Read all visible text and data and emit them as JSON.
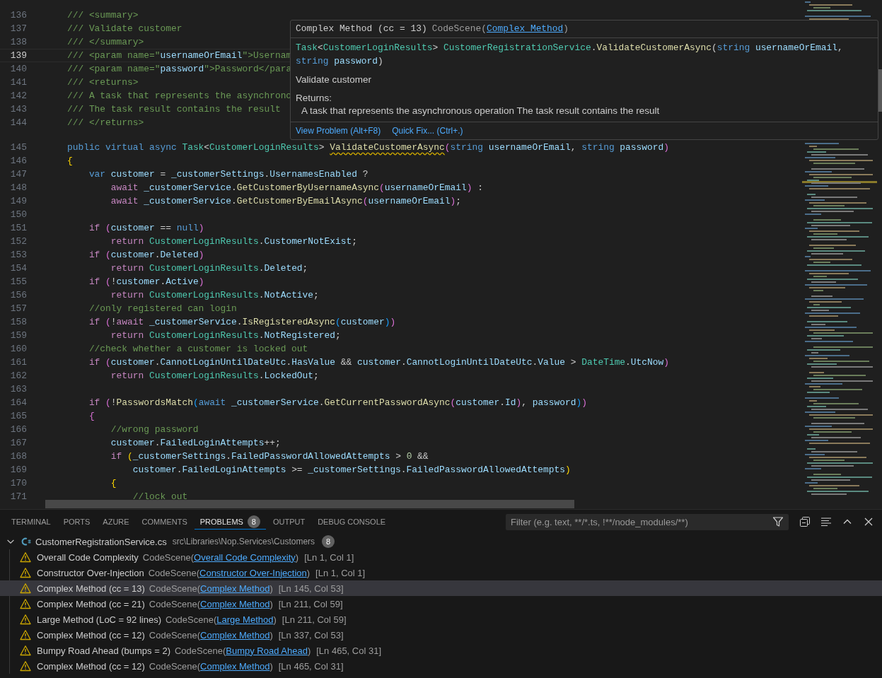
{
  "editor": {
    "lines": [
      {
        "number": "136",
        "current": false,
        "tokens": [
          {
            "text": "    /// <summary>",
            "kind": "cm"
          }
        ]
      },
      {
        "number": "137",
        "current": false,
        "tokens": [
          {
            "text": "    /// Validate customer",
            "kind": "cm"
          }
        ]
      },
      {
        "number": "138",
        "current": false,
        "tokens": [
          {
            "text": "    /// </summary>",
            "kind": "cm"
          }
        ]
      },
      {
        "number": "139",
        "current": true,
        "tokens": [
          {
            "text": "    /// <param name=\"",
            "kind": "cm"
          },
          {
            "text": "usernameOrEmail",
            "kind": "dv"
          },
          {
            "text": "\">Usernam",
            "kind": "cm"
          }
        ]
      },
      {
        "number": "140",
        "current": false,
        "tokens": [
          {
            "text": "    /// <param name=\"",
            "kind": "cm"
          },
          {
            "text": "password",
            "kind": "dv"
          },
          {
            "text": "\">Password</para",
            "kind": "cm"
          }
        ]
      },
      {
        "number": "141",
        "current": false,
        "tokens": [
          {
            "text": "    /// <returns>",
            "kind": "cm"
          }
        ]
      },
      {
        "number": "142",
        "current": false,
        "tokens": [
          {
            "text": "    /// A task that represents the asynchrono",
            "kind": "cm"
          }
        ]
      },
      {
        "number": "143",
        "current": false,
        "tokens": [
          {
            "text": "    /// The task result contains the result",
            "kind": "cm"
          }
        ]
      },
      {
        "number": "144",
        "current": false,
        "tokens": [
          {
            "text": "    /// </returns>",
            "kind": "cm"
          }
        ]
      },
      {
        "number": "145",
        "current": false,
        "tokens": [
          {
            "text": "    public virtual async ",
            "kind": "kw"
          },
          {
            "text": "Task",
            "kind": "ty"
          },
          {
            "text": "<",
            "kind": "p"
          },
          {
            "text": "CustomerLoginResults",
            "kind": "ty"
          },
          {
            "text": "> ",
            "kind": "p"
          },
          {
            "text": "ValidateCustomerAsync",
            "kind": "fnw"
          },
          {
            "text": "(",
            "kind": "b2"
          },
          {
            "text": "string ",
            "kind": "kw"
          },
          {
            "text": "usernameOrEmail",
            "kind": "v"
          },
          {
            "text": ", ",
            "kind": "p"
          },
          {
            "text": "string ",
            "kind": "kw"
          },
          {
            "text": "password",
            "kind": "v"
          },
          {
            "text": ")",
            "kind": "b2"
          }
        ]
      },
      {
        "number": "146",
        "current": false,
        "tokens": [
          {
            "text": "    {",
            "kind": "b1"
          }
        ]
      },
      {
        "number": "147",
        "current": false,
        "tokens": [
          {
            "text": "        var ",
            "kind": "kw"
          },
          {
            "text": "customer",
            "kind": "v"
          },
          {
            "text": " = ",
            "kind": "p"
          },
          {
            "text": "_customerSettings",
            "kind": "v"
          },
          {
            "text": ".",
            "kind": "p"
          },
          {
            "text": "UsernamesEnabled",
            "kind": "v"
          },
          {
            "text": " ?",
            "kind": "p"
          }
        ]
      },
      {
        "number": "148",
        "current": false,
        "tokens": [
          {
            "text": "            await ",
            "kind": "ct"
          },
          {
            "text": "_customerService",
            "kind": "v"
          },
          {
            "text": ".",
            "kind": "p"
          },
          {
            "text": "GetCustomerByUsernameAsync",
            "kind": "fn"
          },
          {
            "text": "(",
            "kind": "b2"
          },
          {
            "text": "usernameOrEmail",
            "kind": "v"
          },
          {
            "text": ")",
            "kind": "b2"
          },
          {
            "text": " :",
            "kind": "p"
          }
        ]
      },
      {
        "number": "149",
        "current": false,
        "tokens": [
          {
            "text": "            await ",
            "kind": "ct"
          },
          {
            "text": "_customerService",
            "kind": "v"
          },
          {
            "text": ".",
            "kind": "p"
          },
          {
            "text": "GetCustomerByEmailAsync",
            "kind": "fn"
          },
          {
            "text": "(",
            "kind": "b2"
          },
          {
            "text": "usernameOrEmail",
            "kind": "v"
          },
          {
            "text": ")",
            "kind": "b2"
          },
          {
            "text": ";",
            "kind": "p"
          }
        ]
      },
      {
        "number": "150",
        "current": false
      },
      {
        "number": "151",
        "current": false,
        "tokens": [
          {
            "text": "        if ",
            "kind": "ct"
          },
          {
            "text": "(",
            "kind": "b2"
          },
          {
            "text": "customer",
            "kind": "v"
          },
          {
            "text": " == ",
            "kind": "p"
          },
          {
            "text": "null",
            "kind": "kw"
          },
          {
            "text": ")",
            "kind": "b2"
          }
        ]
      },
      {
        "number": "152",
        "current": false,
        "tokens": [
          {
            "text": "            return ",
            "kind": "ct"
          },
          {
            "text": "CustomerLoginResults",
            "kind": "ty"
          },
          {
            "text": ".",
            "kind": "p"
          },
          {
            "text": "CustomerNotExist",
            "kind": "v"
          },
          {
            "text": ";",
            "kind": "p"
          }
        ]
      },
      {
        "number": "153",
        "current": false,
        "tokens": [
          {
            "text": "        if ",
            "kind": "ct"
          },
          {
            "text": "(",
            "kind": "b2"
          },
          {
            "text": "customer",
            "kind": "v"
          },
          {
            "text": ".",
            "kind": "p"
          },
          {
            "text": "Deleted",
            "kind": "v"
          },
          {
            "text": ")",
            "kind": "b2"
          }
        ]
      },
      {
        "number": "154",
        "current": false,
        "tokens": [
          {
            "text": "            return ",
            "kind": "ct"
          },
          {
            "text": "CustomerLoginResults",
            "kind": "ty"
          },
          {
            "text": ".",
            "kind": "p"
          },
          {
            "text": "Deleted",
            "kind": "v"
          },
          {
            "text": ";",
            "kind": "p"
          }
        ]
      },
      {
        "number": "155",
        "current": false,
        "tokens": [
          {
            "text": "        if ",
            "kind": "ct"
          },
          {
            "text": "(",
            "kind": "b2"
          },
          {
            "text": "!",
            "kind": "p"
          },
          {
            "text": "customer",
            "kind": "v"
          },
          {
            "text": ".",
            "kind": "p"
          },
          {
            "text": "Active",
            "kind": "v"
          },
          {
            "text": ")",
            "kind": "b2"
          }
        ]
      },
      {
        "number": "156",
        "current": false,
        "tokens": [
          {
            "text": "            return ",
            "kind": "ct"
          },
          {
            "text": "CustomerLoginResults",
            "kind": "ty"
          },
          {
            "text": ".",
            "kind": "p"
          },
          {
            "text": "NotActive",
            "kind": "v"
          },
          {
            "text": ";",
            "kind": "p"
          }
        ]
      },
      {
        "number": "157",
        "current": false,
        "tokens": [
          {
            "text": "        //only registered can login",
            "kind": "cm"
          }
        ]
      },
      {
        "number": "158",
        "current": false,
        "tokens": [
          {
            "text": "        if ",
            "kind": "ct"
          },
          {
            "text": "(",
            "kind": "b2"
          },
          {
            "text": "!",
            "kind": "p"
          },
          {
            "text": "await ",
            "kind": "ct"
          },
          {
            "text": "_customerService",
            "kind": "v"
          },
          {
            "text": ".",
            "kind": "p"
          },
          {
            "text": "IsRegisteredAsync",
            "kind": "fn"
          },
          {
            "text": "(",
            "kind": "b3"
          },
          {
            "text": "customer",
            "kind": "v"
          },
          {
            "text": ")",
            "kind": "b3"
          },
          {
            "text": ")",
            "kind": "b2"
          }
        ]
      },
      {
        "number": "159",
        "current": false,
        "tokens": [
          {
            "text": "            return ",
            "kind": "ct"
          },
          {
            "text": "CustomerLoginResults",
            "kind": "ty"
          },
          {
            "text": ".",
            "kind": "p"
          },
          {
            "text": "NotRegistered",
            "kind": "v"
          },
          {
            "text": ";",
            "kind": "p"
          }
        ]
      },
      {
        "number": "160",
        "current": false,
        "tokens": [
          {
            "text": "        //check whether a customer is locked out",
            "kind": "cm"
          }
        ]
      },
      {
        "number": "161",
        "current": false,
        "tokens": [
          {
            "text": "        if ",
            "kind": "ct"
          },
          {
            "text": "(",
            "kind": "b2"
          },
          {
            "text": "customer",
            "kind": "v"
          },
          {
            "text": ".",
            "kind": "p"
          },
          {
            "text": "CannotLoginUntilDateUtc",
            "kind": "v"
          },
          {
            "text": ".",
            "kind": "p"
          },
          {
            "text": "HasValue",
            "kind": "v"
          },
          {
            "text": " && ",
            "kind": "p"
          },
          {
            "text": "customer",
            "kind": "v"
          },
          {
            "text": ".",
            "kind": "p"
          },
          {
            "text": "CannotLoginUntilDateUtc",
            "kind": "v"
          },
          {
            "text": ".",
            "kind": "p"
          },
          {
            "text": "Value",
            "kind": "v"
          },
          {
            "text": " > ",
            "kind": "p"
          },
          {
            "text": "DateTime",
            "kind": "ty"
          },
          {
            "text": ".",
            "kind": "p"
          },
          {
            "text": "UtcNow",
            "kind": "v"
          },
          {
            "text": ")",
            "kind": "b2"
          }
        ]
      },
      {
        "number": "162",
        "current": false,
        "tokens": [
          {
            "text": "            return ",
            "kind": "ct"
          },
          {
            "text": "CustomerLoginResults",
            "kind": "ty"
          },
          {
            "text": ".",
            "kind": "p"
          },
          {
            "text": "LockedOut",
            "kind": "v"
          },
          {
            "text": ";",
            "kind": "p"
          }
        ]
      },
      {
        "number": "163",
        "current": false
      },
      {
        "number": "164",
        "current": false,
        "tokens": [
          {
            "text": "        if ",
            "kind": "ct"
          },
          {
            "text": "(",
            "kind": "b2"
          },
          {
            "text": "!",
            "kind": "p"
          },
          {
            "text": "PasswordsMatch",
            "kind": "fn"
          },
          {
            "text": "(",
            "kind": "b3"
          },
          {
            "text": "await ",
            "kind": "kw"
          },
          {
            "text": "_customerService",
            "kind": "v"
          },
          {
            "text": ".",
            "kind": "p"
          },
          {
            "text": "GetCurrentPasswordAsync",
            "kind": "fn"
          },
          {
            "text": "(",
            "kind": "b2"
          },
          {
            "text": "customer",
            "kind": "v"
          },
          {
            "text": ".",
            "kind": "p"
          },
          {
            "text": "Id",
            "kind": "v"
          },
          {
            "text": ")",
            "kind": "b2"
          },
          {
            "text": ", ",
            "kind": "p"
          },
          {
            "text": "password",
            "kind": "v"
          },
          {
            "text": ")",
            "kind": "b3"
          },
          {
            "text": ")",
            "kind": "b2"
          }
        ]
      },
      {
        "number": "165",
        "current": false,
        "tokens": [
          {
            "text": "        {",
            "kind": "b2"
          }
        ]
      },
      {
        "number": "166",
        "current": false,
        "tokens": [
          {
            "text": "            //wrong password",
            "kind": "cm"
          }
        ]
      },
      {
        "number": "167",
        "current": false,
        "tokens": [
          {
            "text": "            customer",
            "kind": "v"
          },
          {
            "text": ".",
            "kind": "p"
          },
          {
            "text": "FailedLoginAttempts",
            "kind": "v"
          },
          {
            "text": "++;",
            "kind": "p"
          }
        ]
      },
      {
        "number": "168",
        "current": false,
        "tokens": [
          {
            "text": "            if ",
            "kind": "ct"
          },
          {
            "text": "(",
            "kind": "b1"
          },
          {
            "text": "_customerSettings",
            "kind": "v"
          },
          {
            "text": ".",
            "kind": "p"
          },
          {
            "text": "FailedPasswordAllowedAttempts",
            "kind": "v"
          },
          {
            "text": " > ",
            "kind": "p"
          },
          {
            "text": "0",
            "kind": "n"
          },
          {
            "text": " &&",
            "kind": "p"
          }
        ]
      },
      {
        "number": "169",
        "current": false,
        "tokens": [
          {
            "text": "                customer",
            "kind": "v"
          },
          {
            "text": ".",
            "kind": "p"
          },
          {
            "text": "FailedLoginAttempts",
            "kind": "v"
          },
          {
            "text": " >= ",
            "kind": "p"
          },
          {
            "text": "_customerSettings",
            "kind": "v"
          },
          {
            "text": ".",
            "kind": "p"
          },
          {
            "text": "FailedPasswordAllowedAttempts",
            "kind": "v"
          },
          {
            "text": ")",
            "kind": "b1"
          }
        ]
      },
      {
        "number": "170",
        "current": false,
        "tokens": [
          {
            "text": "            {",
            "kind": "b1"
          }
        ]
      },
      {
        "number": "171",
        "current": false,
        "tokens": [
          {
            "text": "                //lock out",
            "kind": "cm"
          }
        ]
      }
    ]
  },
  "hover": {
    "title": "Complex Method (cc = 13)",
    "source": "CodeScene(",
    "link": "Complex Method",
    "source_end": ")",
    "signature": [
      {
        "text": "Task",
        "kind": "ty"
      },
      {
        "text": "<",
        "kind": "p"
      },
      {
        "text": "CustomerLoginResults",
        "kind": "ty"
      },
      {
        "text": "> ",
        "kind": "p"
      },
      {
        "text": "CustomerRegistrationService",
        "kind": "ty"
      },
      {
        "text": ".",
        "kind": "p"
      },
      {
        "text": "ValidateCustomerAsync",
        "kind": "fn"
      },
      {
        "text": "(",
        "kind": "p"
      },
      {
        "text": "string ",
        "kind": "kw"
      },
      {
        "text": "usernameOrEmail",
        "kind": "v"
      },
      {
        "text": ", ",
        "kind": "p"
      },
      {
        "text": "string ",
        "kind": "kw"
      },
      {
        "text": "password",
        "kind": "v"
      },
      {
        "text": ")",
        "kind": "p"
      }
    ],
    "description": "Validate customer",
    "returns_label": "Returns:",
    "returns": "A task that represents the asynchronous operation The task result contains the result",
    "actions": [
      {
        "label": "View Problem (Alt+F8)"
      },
      {
        "label": "Quick Fix... (Ctrl+.)"
      }
    ]
  },
  "panel": {
    "tabs": [
      {
        "label": "TERMINAL",
        "selected": false
      },
      {
        "label": "PORTS",
        "selected": false
      },
      {
        "label": "AZURE",
        "selected": false
      },
      {
        "label": "COMMENTS",
        "selected": false
      },
      {
        "label": "PROBLEMS",
        "selected": true,
        "badge": "8"
      },
      {
        "label": "OUTPUT",
        "selected": false
      },
      {
        "label": "DEBUG CONSOLE",
        "selected": false
      }
    ],
    "filter": {
      "placeholder": "Filter (e.g. text, **/*.ts, !**/node_modules/**)"
    },
    "file": {
      "name": "CustomerRegistrationService.cs",
      "path": "src\\Libraries\\Nop.Services\\Customers",
      "count": "8",
      "expanded": true
    },
    "problems": [
      {
        "message": "Overall Code Complexity",
        "source": "CodeScene(",
        "link": "Overall Code Complexity",
        "source_end": ")",
        "location": "[Ln 1, Col 1]",
        "selected": false
      },
      {
        "message": "Constructor Over-Injection",
        "source": "CodeScene(",
        "link": "Constructor Over-Injection",
        "source_end": ")",
        "location": "[Ln 1, Col 1]",
        "selected": false
      },
      {
        "message": "Complex Method (cc = 13)",
        "source": "CodeScene(",
        "link": "Complex Method",
        "source_end": ")",
        "location": "[Ln 145, Col 53]",
        "selected": true
      },
      {
        "message": "Complex Method (cc = 21)",
        "source": "CodeScene(",
        "link": "Complex Method",
        "source_end": ")",
        "location": "[Ln 211, Col 59]",
        "selected": false
      },
      {
        "message": "Large Method (LoC = 92 lines)",
        "source": "CodeScene(",
        "link": "Large Method",
        "source_end": ")",
        "location": "[Ln 211, Col 59]",
        "selected": false
      },
      {
        "message": "Complex Method (cc = 12)",
        "source": "CodeScene(",
        "link": "Complex Method",
        "source_end": ")",
        "location": "[Ln 337, Col 53]",
        "selected": false
      },
      {
        "message": "Bumpy Road Ahead (bumps = 2)",
        "source": "CodeScene(",
        "link": "Bumpy Road Ahead",
        "source_end": ")",
        "location": "[Ln 465, Col 31]",
        "selected": false
      },
      {
        "message": "Complex Method (cc = 12)",
        "source": "CodeScene(",
        "link": "Complex Method",
        "source_end": ")",
        "location": "[Ln 465, Col 31]",
        "selected": false
      }
    ]
  }
}
